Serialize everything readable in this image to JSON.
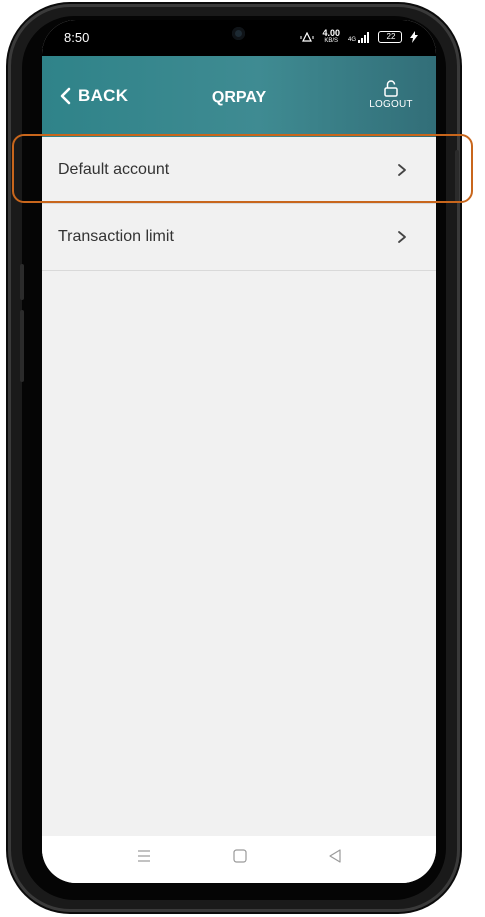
{
  "status_bar": {
    "time": "8:50",
    "speed": "4.00",
    "speed_unit": "KB/S",
    "network": "4G",
    "battery": "22"
  },
  "header": {
    "back_label": "BACK",
    "title": "QRPAY",
    "logout_label": "LOGOUT"
  },
  "menu": {
    "items": [
      {
        "label": "Default account"
      },
      {
        "label": "Transaction limit"
      }
    ]
  },
  "nav": {
    "icons": [
      "menu-icon",
      "home-square-icon",
      "back-triangle-icon"
    ]
  },
  "colors": {
    "header_start": "#2f8389",
    "header_end": "#326e78",
    "highlight": "#c8661c",
    "background": "#f1f1f1"
  }
}
